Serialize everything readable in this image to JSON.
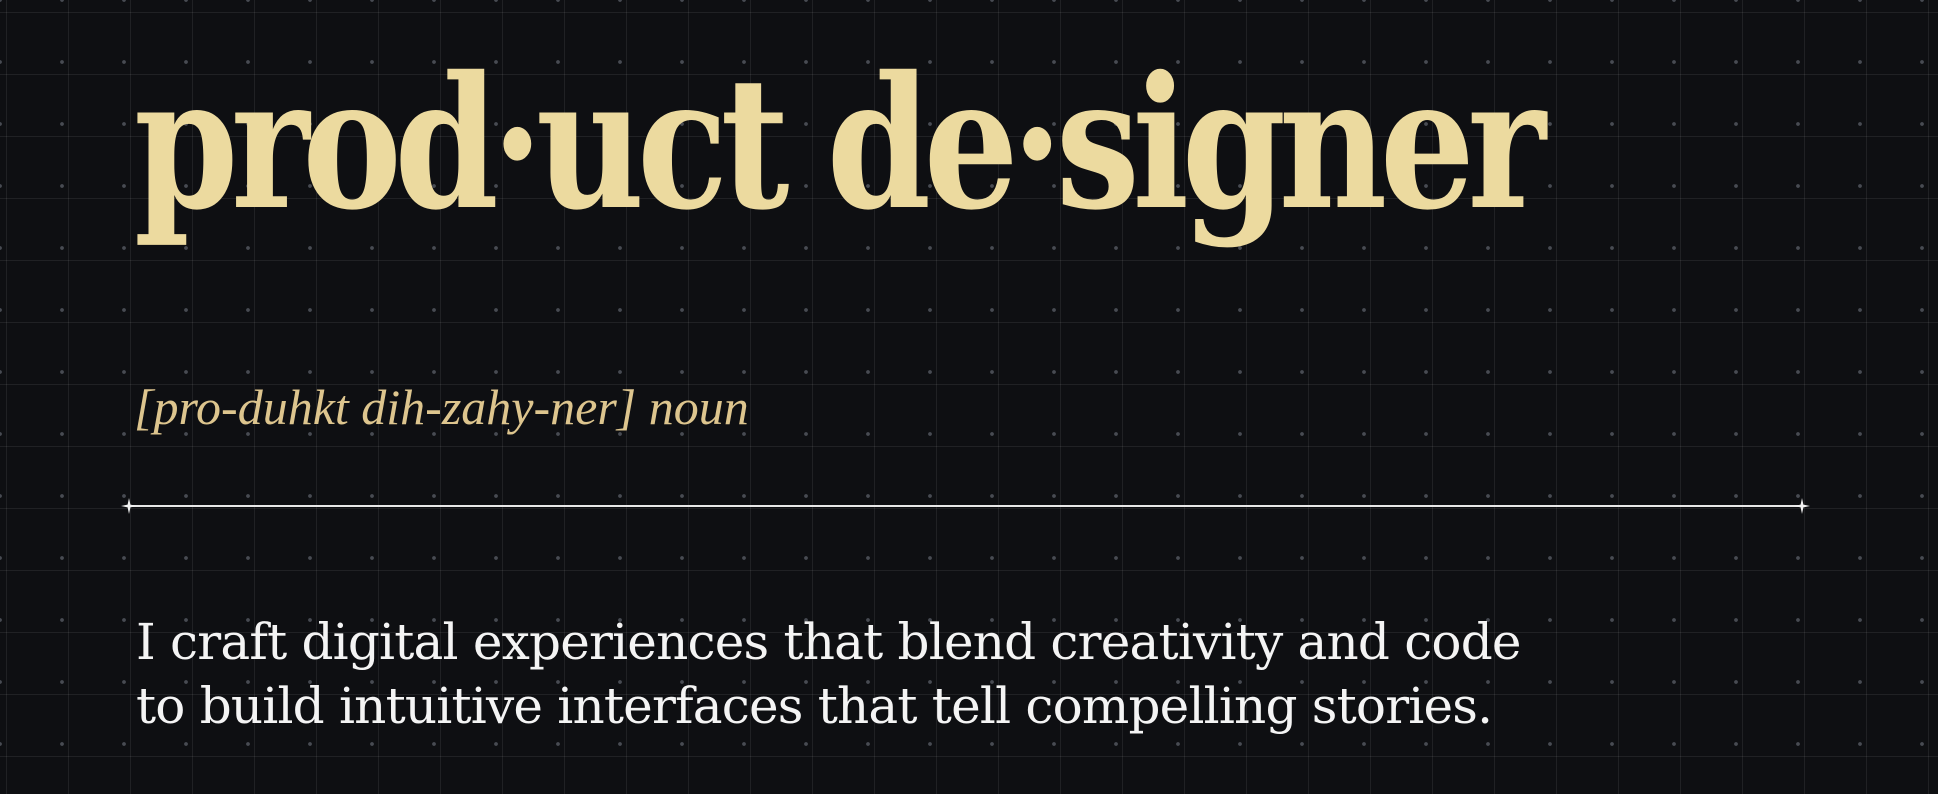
{
  "hero": {
    "title": "prod·uct de·signer",
    "pronunciation": "[pro-duhkt dih-zahy-ner] noun",
    "description_lines": [
      "I craft digital experiences that blend creativity and code",
      "to build intuitive interfaces that tell compelling stories."
    ]
  },
  "colors": {
    "background": "#0e0f12",
    "title": "#ecda9f",
    "pronunciation": "#ddc58e",
    "text": "#f4f4f4",
    "divider": "#e8e8e8"
  },
  "icons": {
    "divider_left": "sparkle-icon",
    "divider_right": "sparkle-icon"
  }
}
